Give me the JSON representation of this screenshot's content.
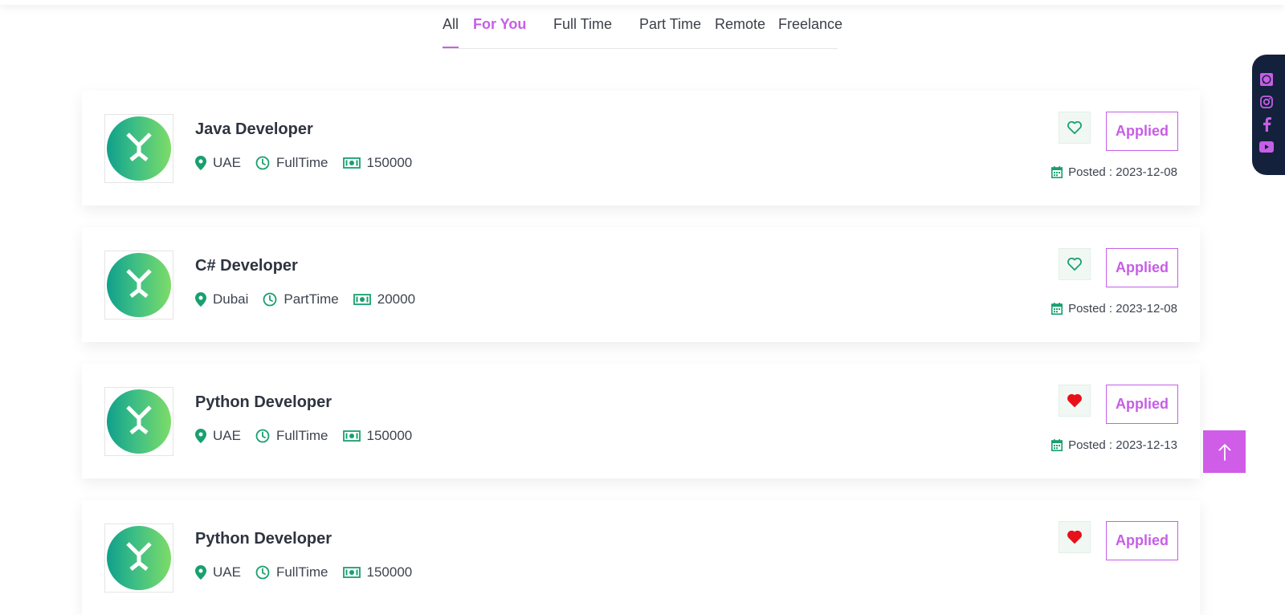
{
  "tabs": [
    {
      "label": "All"
    },
    {
      "label": "For You"
    },
    {
      "label": "Full Time"
    },
    {
      "label": "Part Time"
    },
    {
      "label": "Remote"
    },
    {
      "label": "Freelance"
    }
  ],
  "jobs": [
    {
      "title": "Java Developer",
      "location": "UAE",
      "type": "FullTime",
      "salary": "150000",
      "posted": "Posted : 2023-12-08",
      "favorited": false,
      "action": "Applied"
    },
    {
      "title": "C# Developer",
      "location": "Dubai",
      "type": "PartTime",
      "salary": "20000",
      "posted": "Posted : 2023-12-08",
      "favorited": false,
      "action": "Applied"
    },
    {
      "title": "Python Developer",
      "location": "UAE",
      "type": "FullTime",
      "salary": "150000",
      "posted": "Posted : 2023-12-13",
      "favorited": true,
      "action": "Applied"
    },
    {
      "title": "Python Developer",
      "location": "UAE",
      "type": "FullTime",
      "salary": "150000",
      "posted": "",
      "favorited": true,
      "action": "Applied"
    }
  ],
  "icons": {
    "location": "map-pin-icon",
    "type": "clock-icon",
    "salary": "money-bill-icon",
    "posted": "calendar-icon",
    "favorite": "heart-icon",
    "social": [
      "whatsapp-icon",
      "instagram-icon",
      "facebook-icon",
      "youtube-icon"
    ],
    "scroll_top": "arrow-up-icon"
  },
  "colors": {
    "accent": "#c65ee6",
    "green": "#18a06f",
    "heart_active": "#e8101a",
    "social_bar": "#14213d"
  }
}
